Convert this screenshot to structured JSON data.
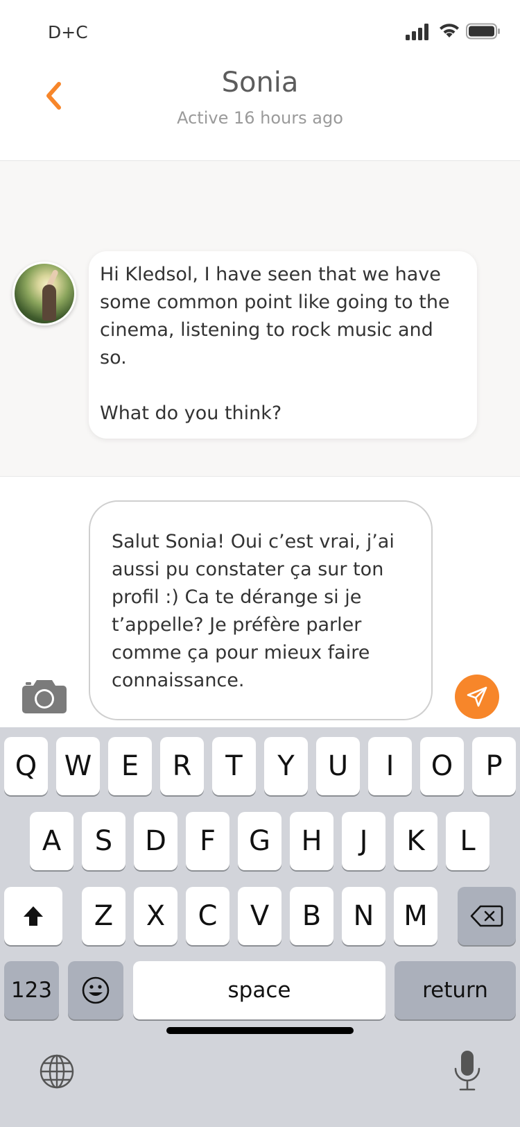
{
  "status_bar": {
    "carrier": "D+C",
    "icons": [
      "cellular-signal-icon",
      "wifi-icon",
      "battery-icon"
    ]
  },
  "header": {
    "back_icon": "chevron-left-icon",
    "name": "Sonia",
    "status": "Active 16 hours ago"
  },
  "conversation": {
    "messages": [
      {
        "sender": "Sonia",
        "text": "Hi Kledsol, I have seen that we have some common point like going to the cinema, listening to rock music and so.\n\nWhat do you think?"
      }
    ]
  },
  "composer": {
    "value": "Salut Sonia! Oui c’est vrai, j’ai aussi pu constater ça sur ton profil :) Ca te dérange si je t’appelle? Je préfère parler comme ça pour mieux faire connaissance.",
    "camera_icon": "camera-icon",
    "send_icon": "send-icon"
  },
  "keyboard": {
    "row1": [
      "Q",
      "W",
      "E",
      "R",
      "T",
      "Y",
      "U",
      "I",
      "O",
      "P"
    ],
    "row2": [
      "A",
      "S",
      "D",
      "F",
      "G",
      "H",
      "J",
      "K",
      "L"
    ],
    "row3": [
      "Z",
      "X",
      "C",
      "V",
      "B",
      "N",
      "M"
    ],
    "numbers_label": "123",
    "space_label": "space",
    "return_label": "return"
  },
  "colors": {
    "accent": "#f7862a",
    "chat_bg": "#f8f7f6",
    "keyboard_bg": "#d2d4da"
  }
}
